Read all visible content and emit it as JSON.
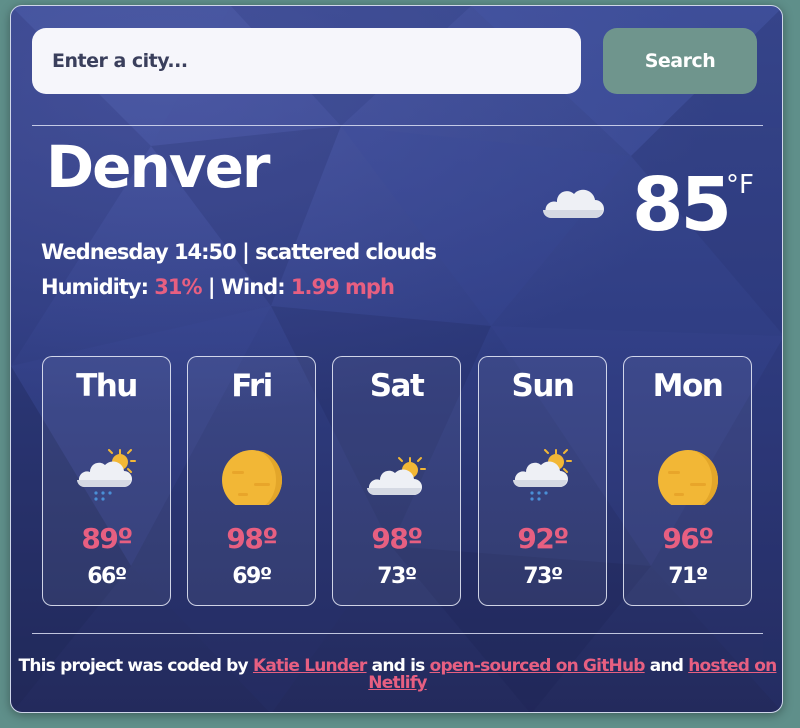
{
  "search": {
    "placeholder": "Enter a city...",
    "button_label": "Search"
  },
  "current": {
    "city": "Denver",
    "day_time": "Wednesday 14:50",
    "separator": "|",
    "description": "scattered clouds",
    "humidity_label": "Humidity:",
    "humidity_value": "31%",
    "wind_label": "Wind:",
    "wind_value": "1.99 mph",
    "temperature": "85",
    "unit": "°F",
    "icon": "cloud-icon"
  },
  "forecast": [
    {
      "day": "Thu",
      "high": "89º",
      "low": "66º",
      "icon": "rain-cloud-sun-icon"
    },
    {
      "day": "Fri",
      "high": "98º",
      "low": "69º",
      "icon": "sun-icon"
    },
    {
      "day": "Sat",
      "high": "98º",
      "low": "73º",
      "icon": "cloud-sun-icon"
    },
    {
      "day": "Sun",
      "high": "92º",
      "low": "73º",
      "icon": "rain-cloud-sun-icon"
    },
    {
      "day": "Mon",
      "high": "96º",
      "low": "71º",
      "icon": "sun-icon"
    }
  ],
  "footer": {
    "prefix": "This project was coded by",
    "author_link": "Katie Lunder",
    "middle": "and is",
    "github_link": "open-sourced on GitHub",
    "and": "and",
    "netlify_link": "hosted on Netlify"
  },
  "colors": {
    "accent": "#e75f81",
    "button": "#6f958d",
    "background_top": "#3b4b92",
    "background_bottom": "#232a5c"
  }
}
